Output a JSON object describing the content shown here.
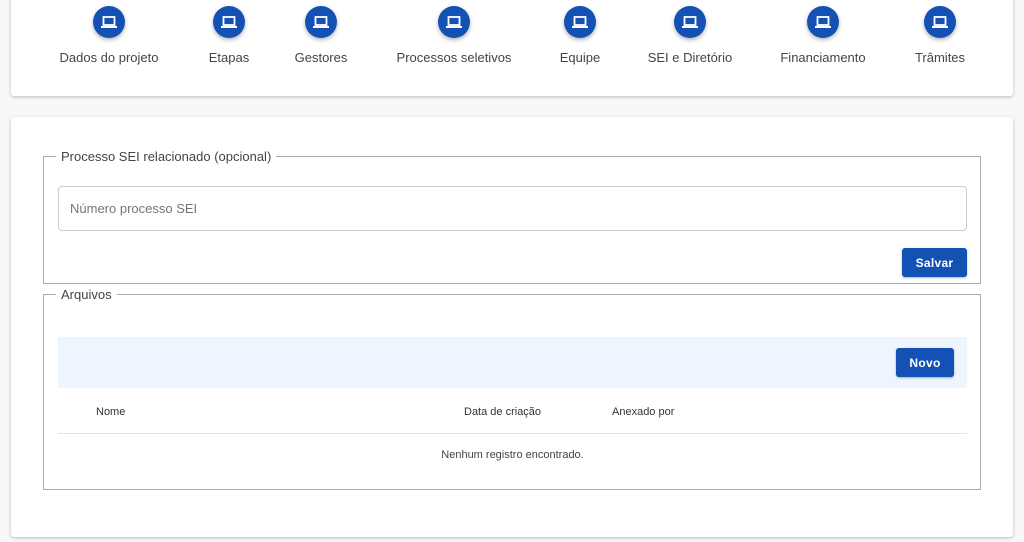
{
  "steps": [
    {
      "label": "Dados do projeto",
      "icon": "laptop-icon"
    },
    {
      "label": "Etapas",
      "icon": "laptop-icon"
    },
    {
      "label": "Gestores",
      "icon": "laptop-icon"
    },
    {
      "label": "Processos seletivos",
      "icon": "laptop-icon"
    },
    {
      "label": "Equipe",
      "icon": "laptop-icon"
    },
    {
      "label": "SEI e Diretório",
      "icon": "laptop-icon"
    },
    {
      "label": "Financiamento",
      "icon": "laptop-icon"
    },
    {
      "label": "Trâmites",
      "icon": "laptop-icon"
    }
  ],
  "sei": {
    "legend": "Processo SEI relacionado (opcional)",
    "placeholder": "Número processo SEI",
    "save_label": "Salvar"
  },
  "files": {
    "legend": "Arquivos",
    "new_label": "Novo",
    "columns": [
      "Nome",
      "Data de criação",
      "Anexado por"
    ],
    "empty": "Nenhum registro encontrado."
  },
  "colors": {
    "primary": "#1351b4",
    "toolbar": "#eef5ff"
  }
}
